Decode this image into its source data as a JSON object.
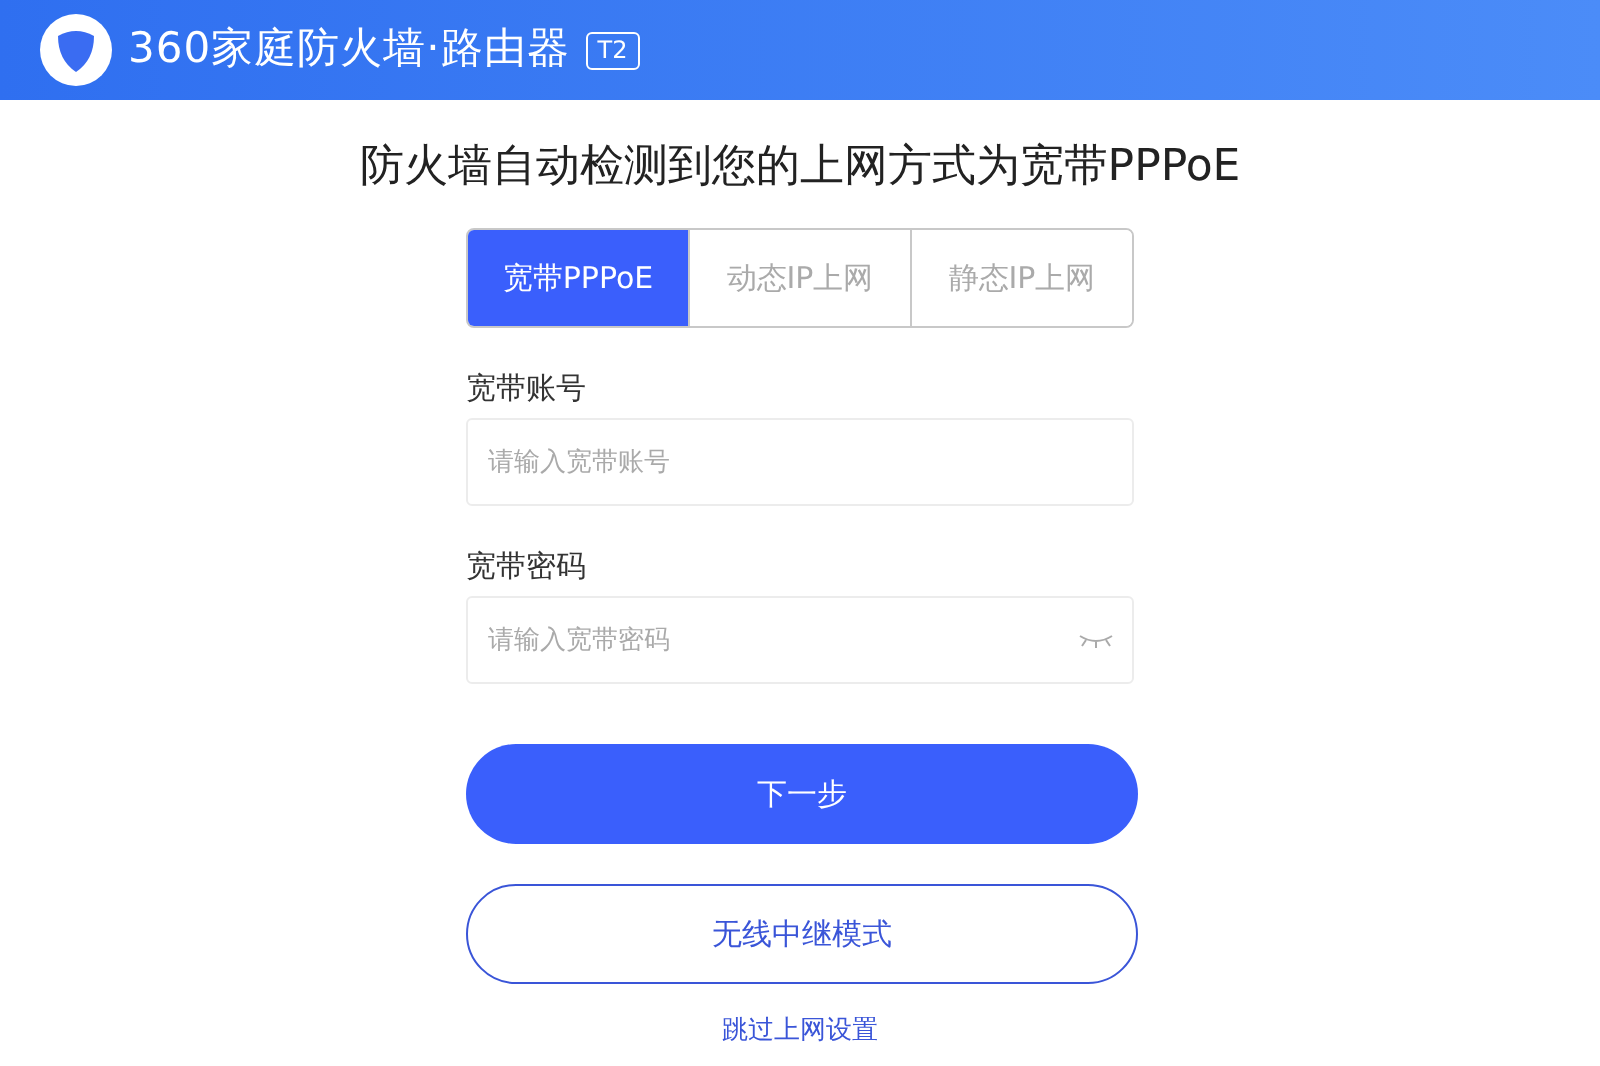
{
  "header": {
    "brand": "360家庭防火墙·路由器",
    "model_badge": "T2"
  },
  "heading": "防火墙自动检测到您的上网方式为宽带PPPoE",
  "tabs": [
    {
      "label": "宽带PPPoE",
      "selected": true
    },
    {
      "label": "动态IP上网",
      "selected": false
    },
    {
      "label": "静态IP上网",
      "selected": false
    }
  ],
  "fields": [
    {
      "label": "宽带账号",
      "placeholder": "请输入宽带账号",
      "kind": "text"
    },
    {
      "label": "宽带密码",
      "placeholder": "请输入宽带密码",
      "kind": "password"
    }
  ],
  "primary_button": "下一步",
  "secondary_button": "无线中继模式",
  "skip_link": "跳过上网设置"
}
